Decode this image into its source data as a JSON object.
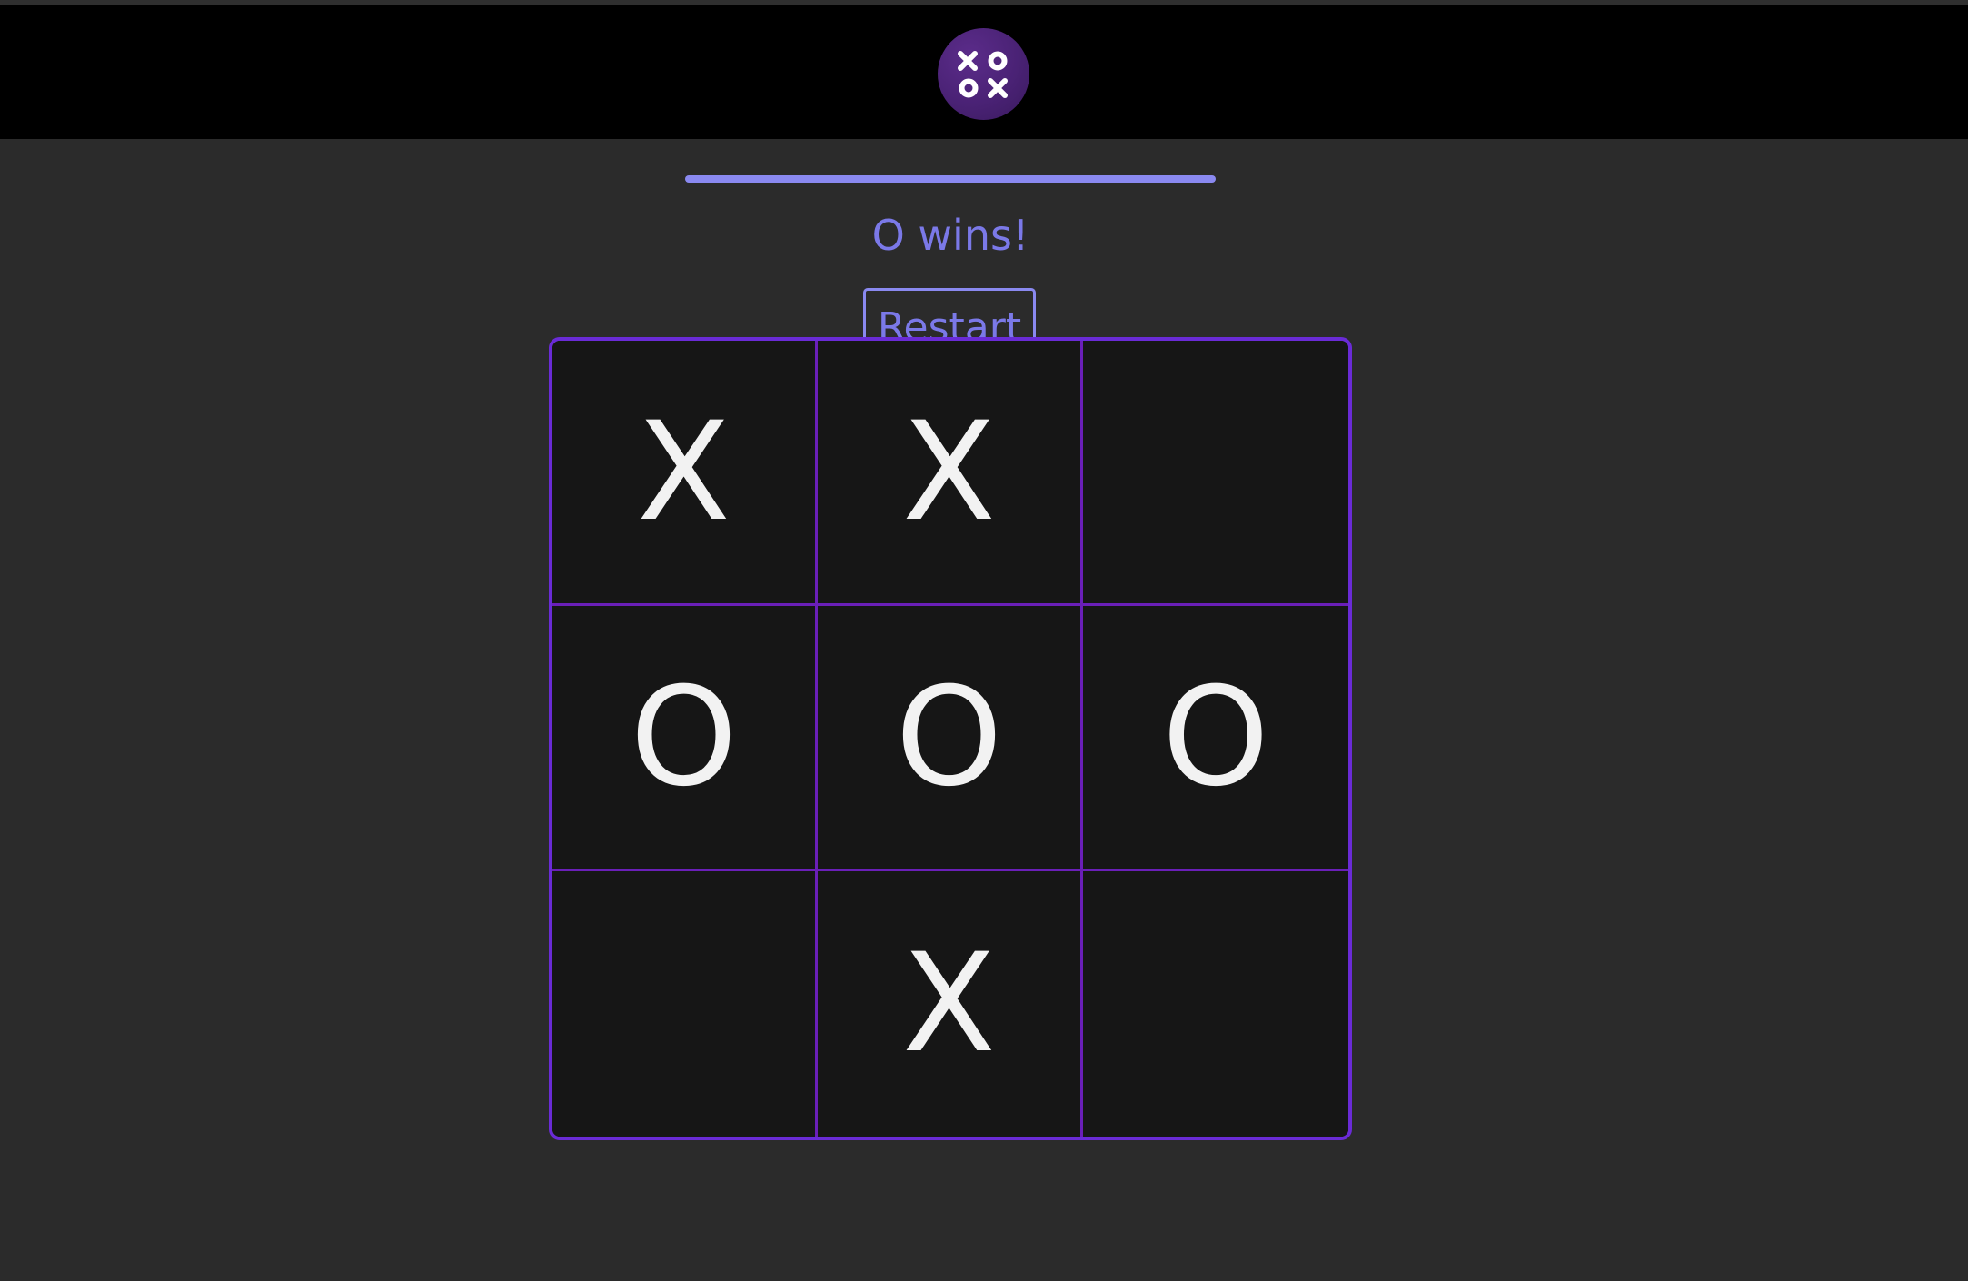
{
  "app": {
    "logo_icon": "xo-logo-icon"
  },
  "status": {
    "text": "O wins!"
  },
  "controls": {
    "restart_label": "Restart"
  },
  "board": {
    "cells": [
      "X",
      "X",
      "",
      "O",
      "O",
      "O",
      "",
      "X",
      ""
    ]
  },
  "colors": {
    "accent": "#7b79e8",
    "board_border": "#6a2bd6",
    "grid_lines": "#6a1fb8",
    "cell_background": "#161616",
    "page_background": "#2b2b2b",
    "header_background": "#000000"
  }
}
